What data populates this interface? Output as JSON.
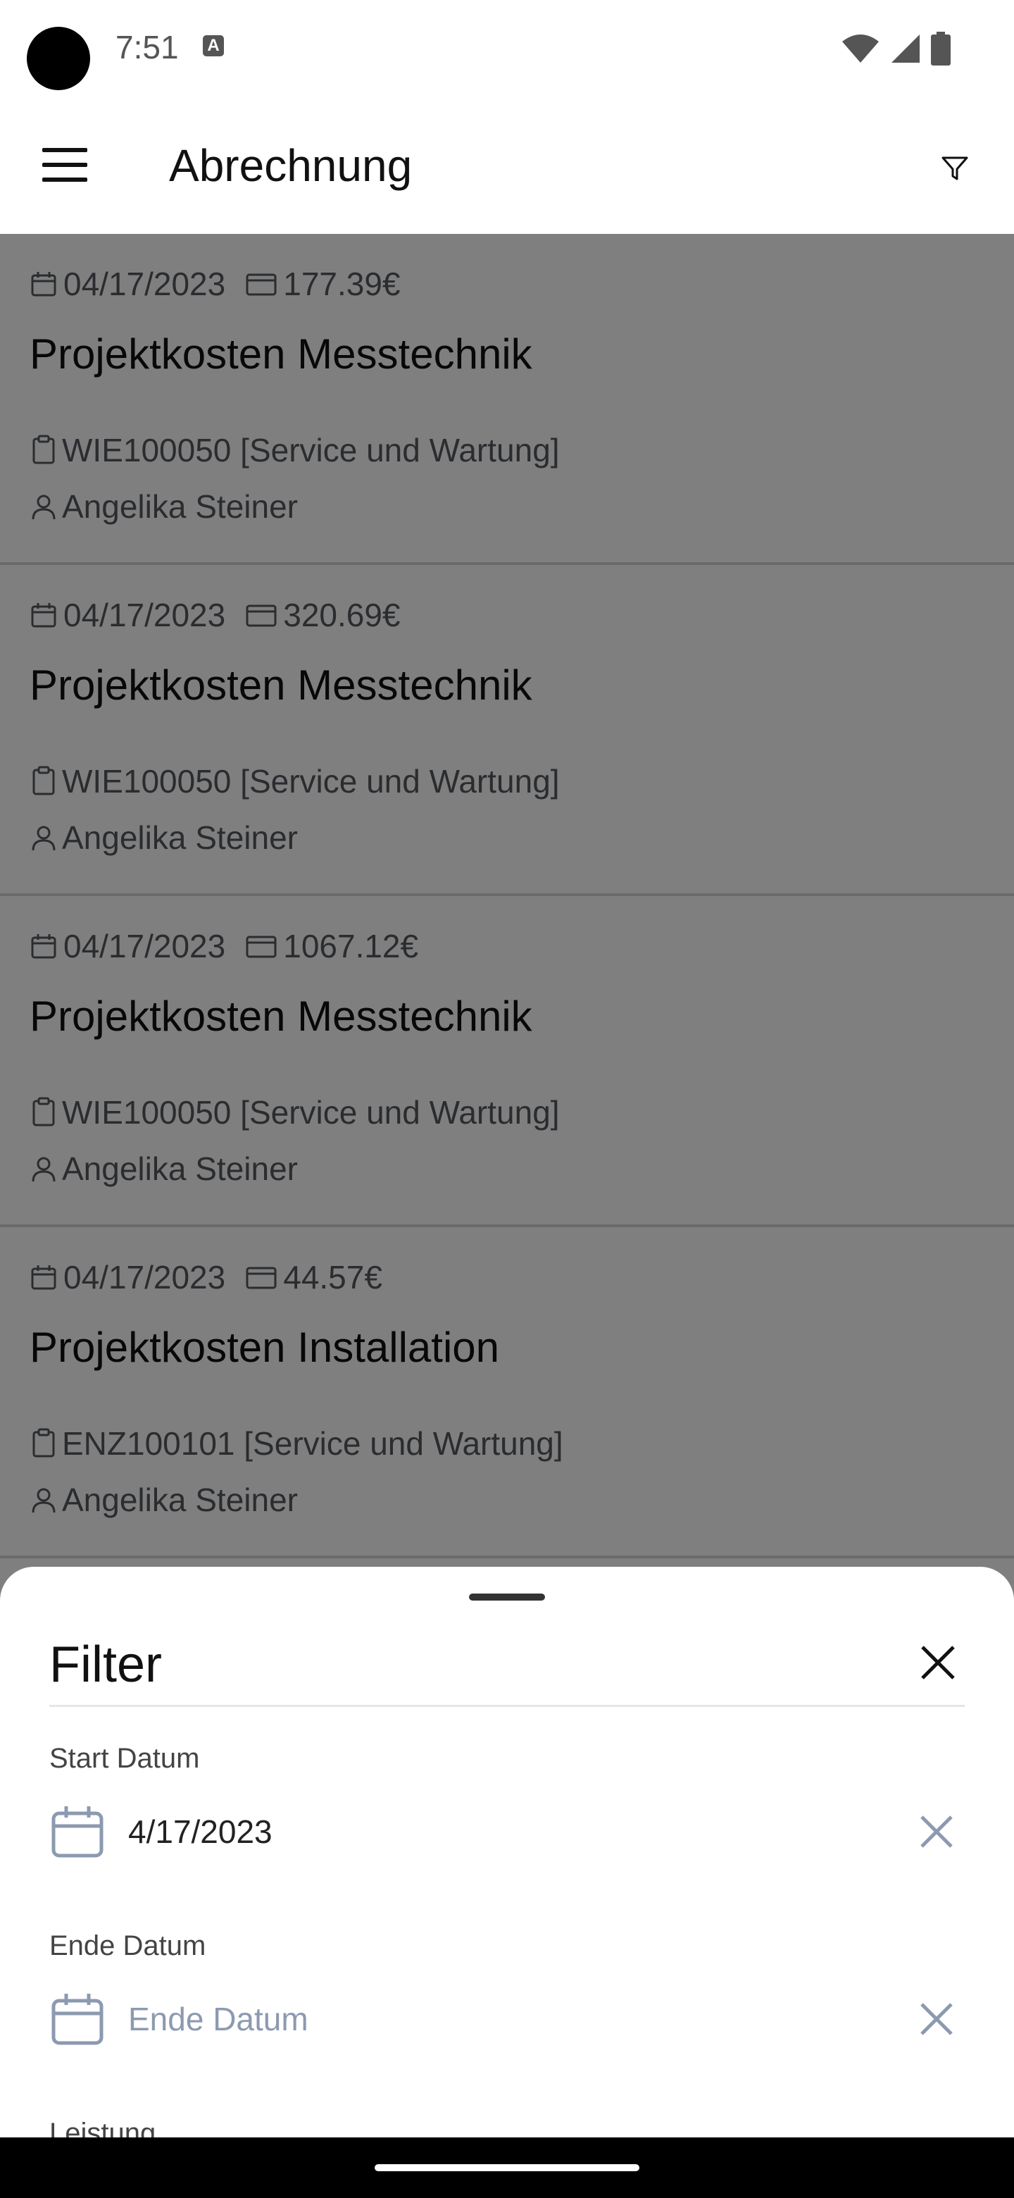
{
  "status_bar": {
    "time": "7:51",
    "indicator": "A"
  },
  "app_bar": {
    "title": "Abrechnung",
    "menu_icon": "hamburger-menu-icon",
    "filter_icon": "filter-icon"
  },
  "entries": [
    {
      "date": "04/17/2023",
      "amount": "177.39€",
      "title": "Projektkosten Messtechnik",
      "project": "WIE100050 [Service und Wartung]",
      "person": "Angelika Steiner"
    },
    {
      "date": "04/17/2023",
      "amount": "320.69€",
      "title": "Projektkosten Messtechnik",
      "project": "WIE100050 [Service und Wartung]",
      "person": "Angelika Steiner"
    },
    {
      "date": "04/17/2023",
      "amount": "1067.12€",
      "title": "Projektkosten Messtechnik",
      "project": "WIE100050 [Service und Wartung]",
      "person": "Angelika Steiner"
    },
    {
      "date": "04/17/2023",
      "amount": "44.57€",
      "title": "Projektkosten Installation",
      "project": "ENZ100101 [Service und Wartung]",
      "person": "Angelika Steiner"
    }
  ],
  "filter_sheet": {
    "title": "Filter",
    "start": {
      "label": "Start Datum",
      "value": "4/17/2023"
    },
    "end": {
      "label": "Ende Datum",
      "placeholder": "Ende Datum",
      "value": ""
    },
    "next_label": "Leistung"
  },
  "colors": {
    "overlay": "#00000080",
    "placeholder": "#8c9ab0",
    "meta_text": "#55595f"
  }
}
